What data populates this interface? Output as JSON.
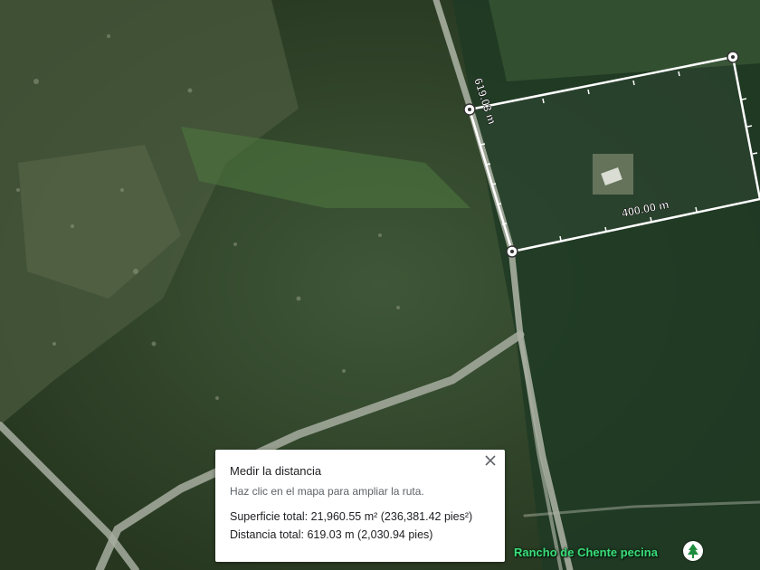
{
  "measurement": {
    "side_length_label": "619.03 m",
    "bottom_length_label": "400.00 m"
  },
  "card": {
    "title": "Medir la distancia",
    "hint": "Haz clic en el mapa para ampliar la ruta.",
    "area_text": "Superficie total: 21,960.55 m² (236,381.42 pies²)",
    "distance_text": "Distancia total: 619.03 m (2,030.94 pies)"
  },
  "place": {
    "name": "Rancho de Chente pecina",
    "icon": "tree-icon"
  },
  "colors": {
    "measure_line": "#ffffff",
    "place_label": "#3bdc7a"
  }
}
